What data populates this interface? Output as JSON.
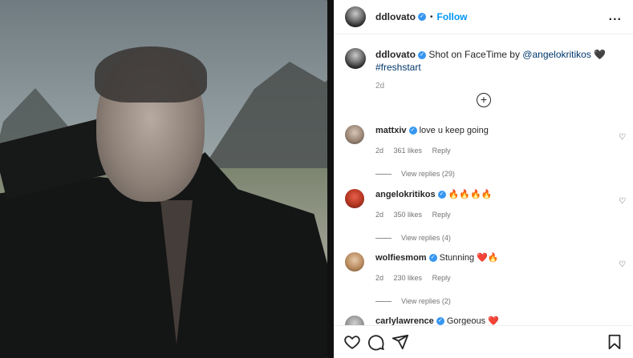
{
  "post": {
    "author": "ddlovato",
    "follow_label": "Follow",
    "separator": "•",
    "more_label": "...",
    "caption_prefix": "Shot on FaceTime by ",
    "caption_mention": "@angelokritikos",
    "caption_heart": "🖤",
    "caption_hashtag": "#freshstart",
    "time": "2d"
  },
  "comments": [
    {
      "user": "mattxiv",
      "text": "love u keep going",
      "time": "2d",
      "likes": "361 likes",
      "reply": "Reply",
      "view_replies": "View replies (29)"
    },
    {
      "user": "angelokritikos",
      "text": "🔥🔥🔥🔥",
      "time": "2d",
      "likes": "350 likes",
      "reply": "Reply",
      "view_replies": "View replies (4)"
    },
    {
      "user": "wolfiesmom",
      "text": "Stunning ❤️🔥",
      "time": "2d",
      "likes": "230 likes",
      "reply": "Reply",
      "view_replies": "View replies (2)"
    },
    {
      "user": "carlylawrence",
      "text": "Gorgeous ❤️"
    }
  ],
  "icons": {
    "verified": "verified-badge-icon",
    "load_more": "plus-circle-icon",
    "like": "heart-icon",
    "comment": "comment-icon",
    "share": "share-icon",
    "save": "bookmark-icon"
  },
  "colors": {
    "accent": "#0095f6",
    "verified": "#3797f0",
    "mention": "#00376b"
  }
}
